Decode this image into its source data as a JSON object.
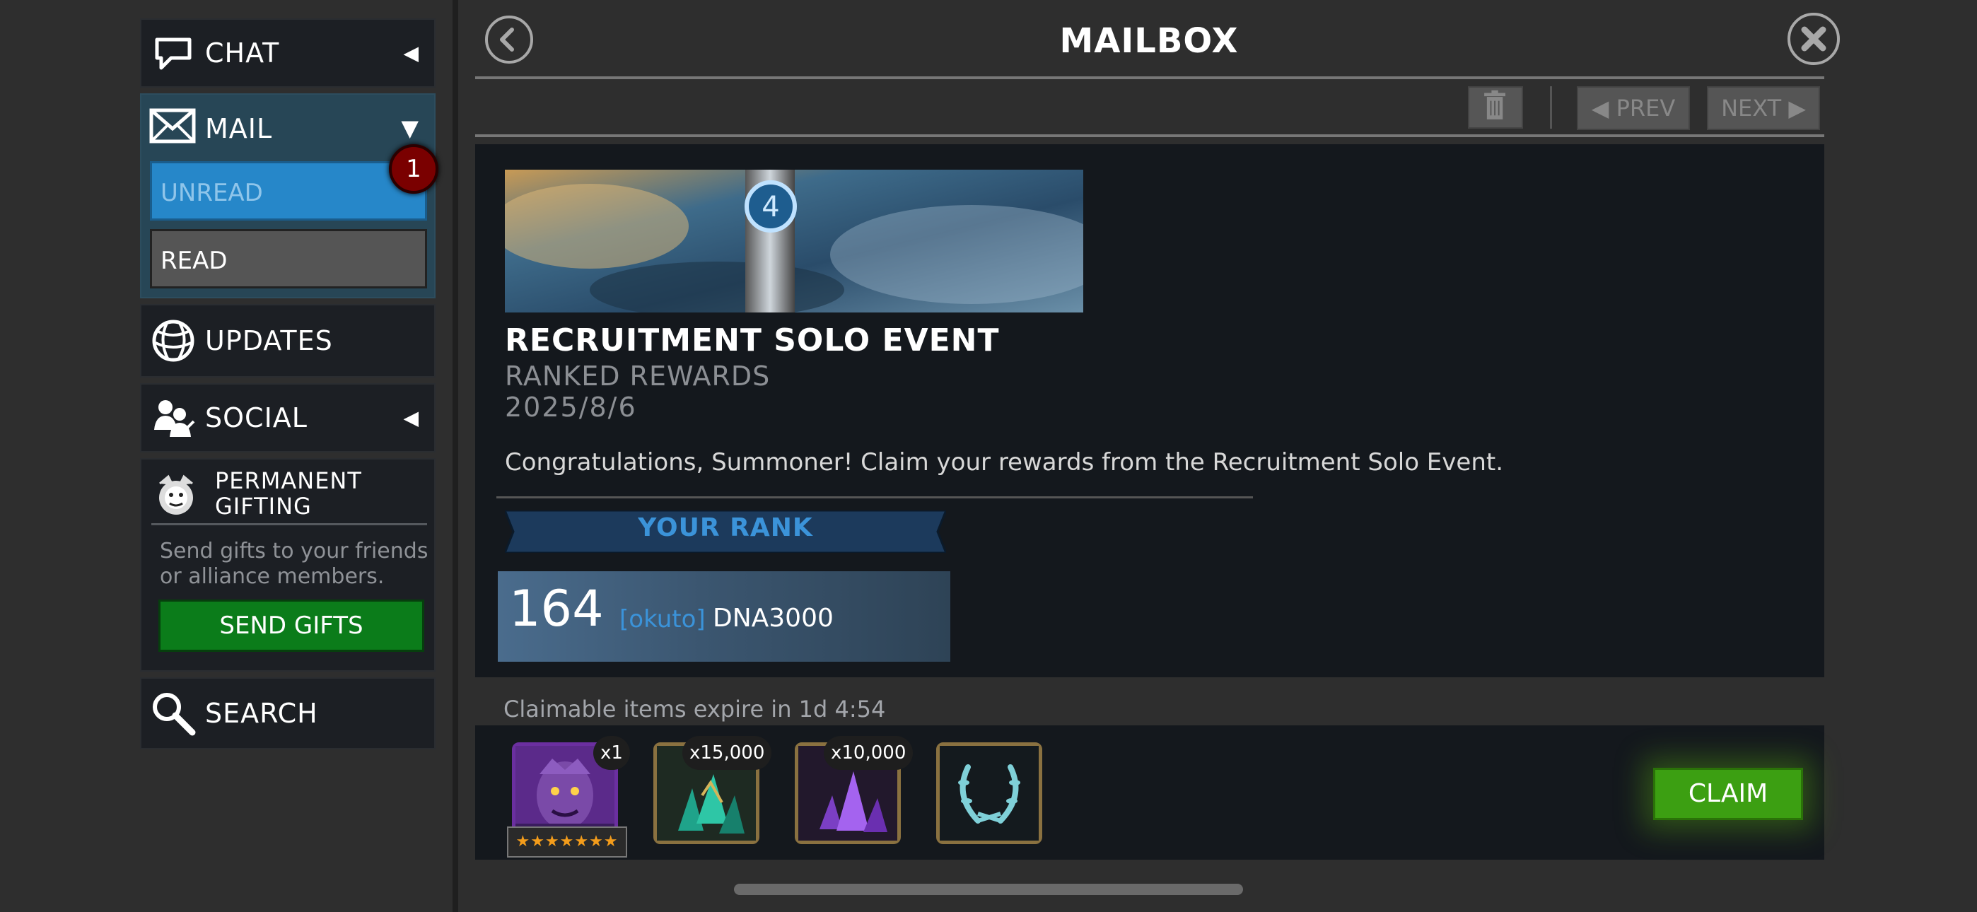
{
  "sidebar": {
    "chat_label": "CHAT",
    "mail_label": "MAIL",
    "unread_label": "UNREAD",
    "unread_count": "1",
    "read_label": "READ",
    "updates_label": "UPDATES",
    "social_label": "SOCIAL",
    "gifting_label_1": "PERMANENT",
    "gifting_label_2": "GIFTING",
    "gifting_desc": "Send gifts to your friends or alliance members.",
    "send_gifts_label": "SEND GIFTS",
    "search_label": "SEARCH"
  },
  "header": {
    "title": "MAILBOX",
    "prev_label": "◀ PREV",
    "next_label": "NEXT ▶"
  },
  "message": {
    "title": "RECRUITMENT SOLO EVENT",
    "subtitle": "RANKED REWARDS",
    "date": "2025/8/6",
    "body": "Congratulations, Summoner! Claim your rewards from the Recruitment Solo Event.",
    "rank_heading": "YOUR RANK",
    "rank": "164",
    "alliance_tag": "[okuto]",
    "player_name": "DNA3000"
  },
  "rewards": {
    "expire_text": "Claimable items expire in 1d 4:54",
    "items": [
      {
        "icon": "champion-portrait-icon",
        "qty": "x1",
        "stars": "★★★★★★★"
      },
      {
        "icon": "teal-crystal-shards-icon",
        "qty": "x15,000"
      },
      {
        "icon": "purple-crystal-shards-icon",
        "qty": "x10,000"
      },
      {
        "icon": "laurel-wreath-icon"
      }
    ],
    "claim_label": "CLAIM"
  },
  "colors": {
    "accent_blue": "#2687c9",
    "claim_green": "#3c9f12",
    "send_green": "#0b7c1a",
    "badge_red": "#7a0000"
  }
}
